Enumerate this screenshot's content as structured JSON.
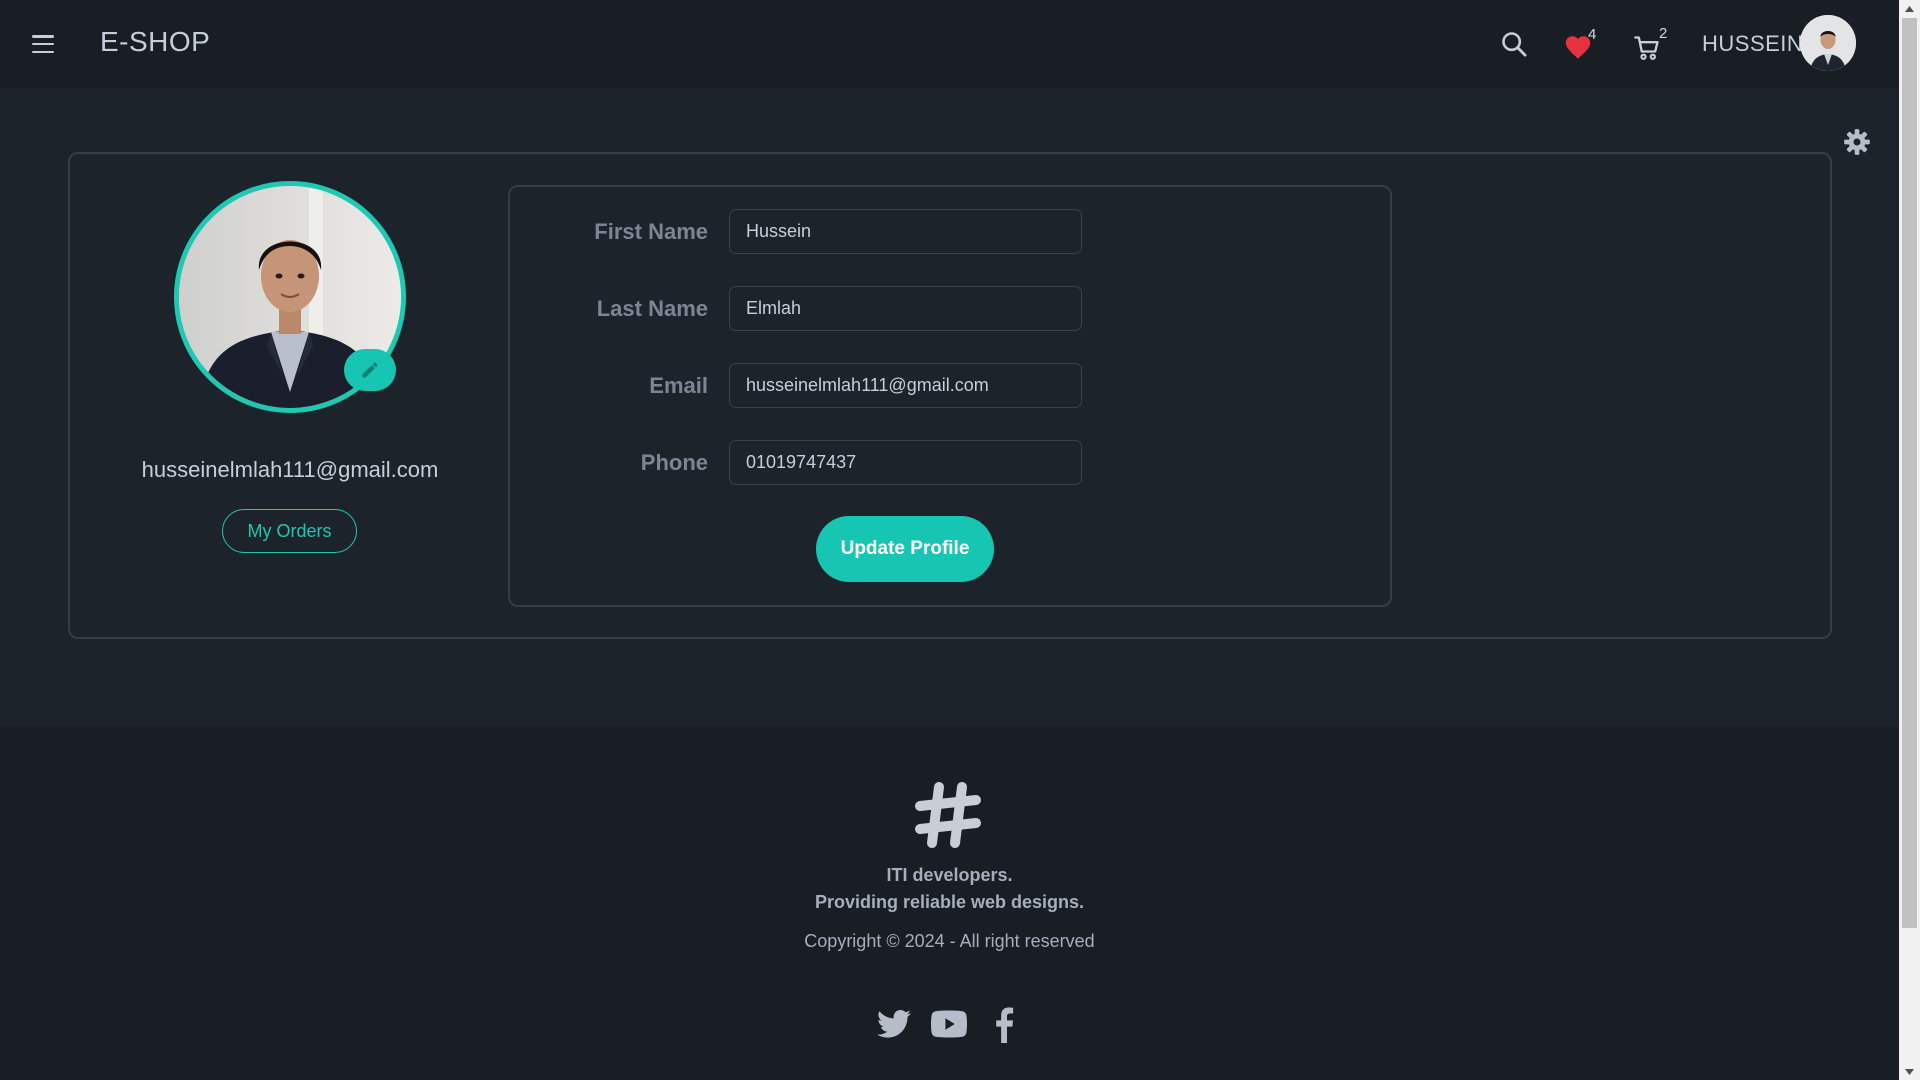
{
  "navbar": {
    "brand": "E-SHOP",
    "wishlist_count": "4",
    "cart_count": "2",
    "user_name": "HUSSEIN"
  },
  "profile": {
    "email": "husseinelmlah111@gmail.com",
    "my_orders_label": "My Orders",
    "accent_color": "#1fc8b3"
  },
  "form": {
    "first_name_label": "First Name",
    "first_name_value": "Hussein",
    "last_name_label": "Last Name",
    "last_name_value": "Elmlah",
    "email_label": "Email",
    "email_value": "husseinelmlah111@gmail.com",
    "phone_label": "Phone",
    "phone_value": "01019747437",
    "update_label": "Update Profile"
  },
  "footer": {
    "line1": "ITI developers.",
    "line2": "Providing reliable web designs.",
    "copyright": "Copyright © 2024 - All right reserved",
    "social": [
      "twitter-icon",
      "youtube-icon",
      "facebook-icon"
    ]
  },
  "icons": {
    "menu": "hamburger-menu-icon",
    "search": "search-icon",
    "wishlist": "heart-icon",
    "cart": "cart-icon",
    "settings": "gear-icon",
    "edit": "pencil-icon",
    "logo": "hashtag-logo-icon"
  }
}
